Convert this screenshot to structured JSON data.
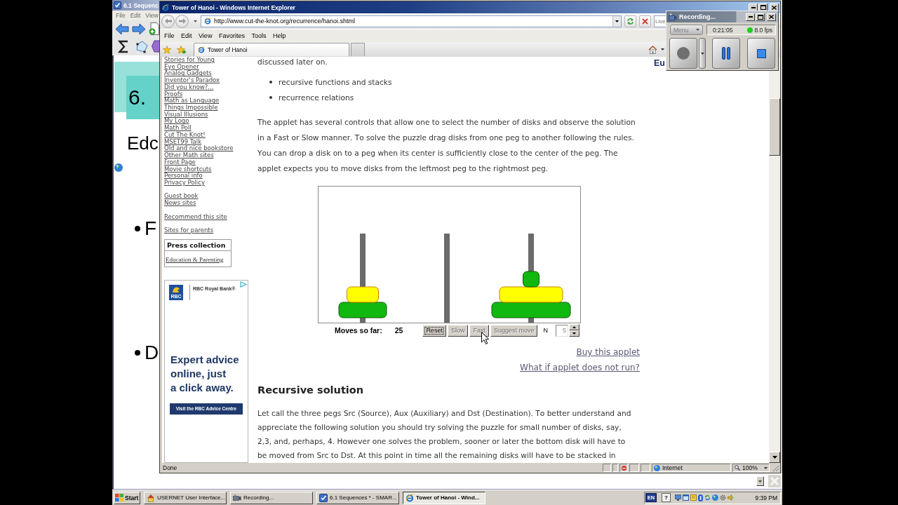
{
  "notebook_window": {
    "title": "6.1 Sequenc",
    "menu": [
      "File",
      "Edit",
      "View"
    ],
    "slide": {
      "number": "6.",
      "heading": "Edc",
      "bullets": [
        "F",
        "D"
      ]
    }
  },
  "browser": {
    "title": "Tower of Hanoi - Windows Internet Explorer",
    "address": "http://www.cut-the-knot.org/recurrence/hanoi.shtml",
    "search": {
      "placeholder": "Live"
    },
    "menu": [
      "File",
      "Edit",
      "View",
      "Favorites",
      "Tools",
      "Help"
    ],
    "tabs": [
      {
        "label": "Tower of Hanoi",
        "selected": true
      }
    ],
    "page": {
      "sidebar": {
        "link_groups": [
          [
            "Stories for Young",
            "Eye Opener",
            "Analog Gadgets",
            "Inventor's Paradox",
            "Did you know?...",
            "Proofs",
            "Math as Language",
            "Things Impossible",
            "Visual Illusions",
            "My Logo",
            "Math Poll",
            "Cut The Knot!",
            "MSET99 Talk",
            "Old and nice bookstore",
            "Other Math sites",
            "Front Page",
            "Movie shortcuts",
            "Personal info",
            "Privacy Policy"
          ],
          [
            "Guest book",
            "News sites"
          ],
          [
            "Recommend this site"
          ],
          [
            "Sites for parents"
          ]
        ],
        "press_box": {
          "title": "Press collection",
          "link": "Education & Parenting"
        },
        "ad": {
          "logo": "RBC",
          "brand": "RBC Royal Bank®",
          "headline": "Expert advice\nonline, just\na click away.",
          "button": "Visit the RBC Advice Centre"
        }
      },
      "logo": "Eu",
      "intro_tail": "discussed later on.",
      "bullets": [
        "recursive functions and stacks",
        "recurrence relations"
      ],
      "paragraph": "The applet has several controls that allow one to select the number of disks and observe the solution in a Fast or Slow manner. To solve the puzzle drag disks from one peg to another following the rules. You can drop a disk on to a peg when its center is sufficiently close to the center of the peg. The applet expects you to move disks from the leftmost peg to the rightmost peg.",
      "applet": {
        "left_peg": [
          {
            "kind": "medium",
            "color": "#10b810"
          },
          {
            "kind": "small",
            "color": "#ffff00"
          }
        ],
        "right_peg": [
          {
            "kind": "largest",
            "color": "#10b810"
          },
          {
            "kind": "large",
            "color": "#ffff00"
          },
          {
            "kind": "smallest",
            "color": "#10b810"
          }
        ],
        "moves_label": "Moves so far:",
        "moves": "25",
        "buttons": [
          {
            "label": "Reset",
            "disabled": false,
            "focused": true
          },
          {
            "label": "Slow",
            "disabled": true,
            "focused": false
          },
          {
            "label": "Fast",
            "disabled": true,
            "focused": false
          },
          {
            "label": "Suggest move",
            "disabled": true,
            "focused": false
          }
        ],
        "n_field": {
          "label": "N",
          "value": "5",
          "disabled": true
        }
      },
      "links": [
        "Buy this applet",
        "What if applet does not run?"
      ],
      "section": {
        "heading": "Recursive solution",
        "paragraph": "Let call the three pegs Src (Source), Aux (Auxiliary) and Dst (Destination). To better understand and appreciate the following solution you should try solving the puzzle for small number of disks, say, 2,3, and, perhaps, 4. However one solves the problem, sooner or later the bottom disk will have to be moved from Src to Dst. At this point in time all the remaining disks will have to be stacked in"
      }
    },
    "status_bar": {
      "text": "Done",
      "zone": "Internet",
      "zoom": "100%"
    }
  },
  "recorder": {
    "title": "Recording...",
    "menu_button": {
      "label": "Menu",
      "disabled": true
    },
    "elapsed": "0:21:05",
    "frame_rate": "8.0 fps"
  },
  "taskbar": {
    "start": "Start",
    "tasks": [
      {
        "kind": "house",
        "label": "USERNET User Interface...",
        "selected": false
      },
      {
        "kind": "camera",
        "label": "Recording...",
        "selected": false
      },
      {
        "kind": "notebook",
        "label": "6.1 Sequences * - SMAR...",
        "selected": false
      },
      {
        "kind": "browser",
        "label": "Tower of Hanoi - Wind...",
        "selected": true
      }
    ],
    "language": "EN",
    "help": "?",
    "clock": "9:39 PM"
  }
}
